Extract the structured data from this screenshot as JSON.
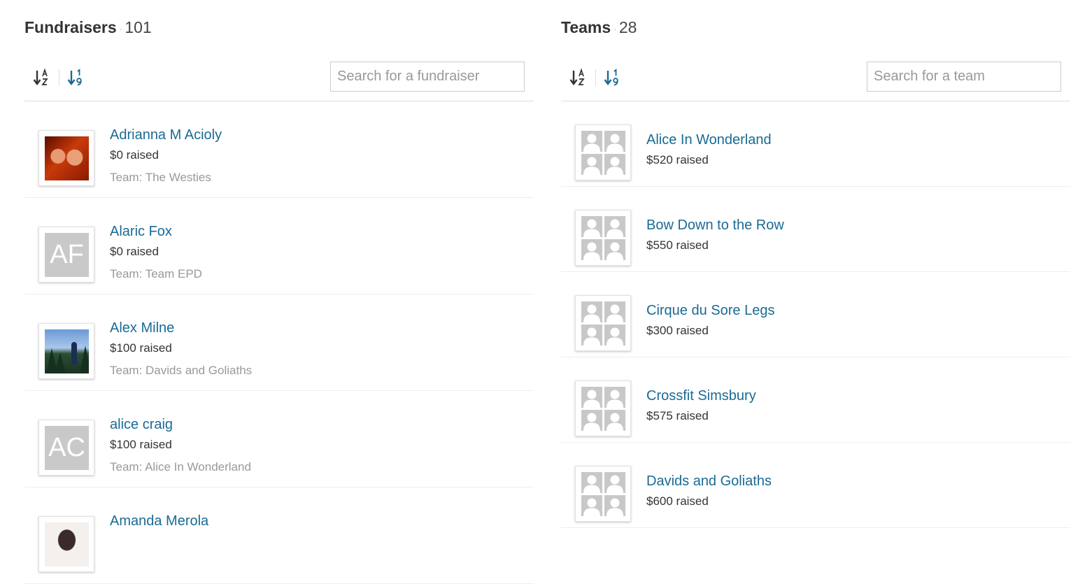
{
  "fundraisers": {
    "title": "Fundraisers",
    "separator": "·",
    "count": "101",
    "search_placeholder": "Search for a fundraiser",
    "sort_icons": [
      "sort-alpha-icon",
      "sort-numeric-icon"
    ],
    "items": [
      {
        "name": "Adrianna M Acioly",
        "raised": "$0 raised",
        "team": "Team: The Westies",
        "avatar": "photo"
      },
      {
        "name": "Alaric Fox",
        "raised": "$0 raised",
        "team": "Team: Team EPD",
        "avatar": "initials",
        "initials": "AF"
      },
      {
        "name": "Alex Milne",
        "raised": "$100 raised",
        "team": "Team: Davids and Goliaths",
        "avatar": "photo"
      },
      {
        "name": "alice craig",
        "raised": "$100 raised",
        "team": "Team: Alice In Wonderland",
        "avatar": "initials",
        "initials": "AC"
      },
      {
        "name": "Amanda Merola",
        "raised": "",
        "team": "",
        "avatar": "photo"
      }
    ]
  },
  "teams": {
    "title": "Teams",
    "separator": "·",
    "count": "28",
    "search_placeholder": "Search for a team",
    "sort_icons": [
      "sort-alpha-icon",
      "sort-numeric-icon"
    ],
    "items": [
      {
        "name": "Alice In Wonderland",
        "raised": "$520 raised"
      },
      {
        "name": "Bow Down to the Row",
        "raised": "$550 raised"
      },
      {
        "name": "Cirque du Sore Legs",
        "raised": "$300 raised"
      },
      {
        "name": "Crossfit Simsbury",
        "raised": "$575 raised"
      },
      {
        "name": "Davids and Goliaths",
        "raised": "$600 raised"
      }
    ]
  },
  "colors": {
    "link": "#1a6a94",
    "active_sort": "#1a6a94",
    "inactive_sort": "#333333",
    "placeholder_avatar": "#c9c9c9"
  }
}
